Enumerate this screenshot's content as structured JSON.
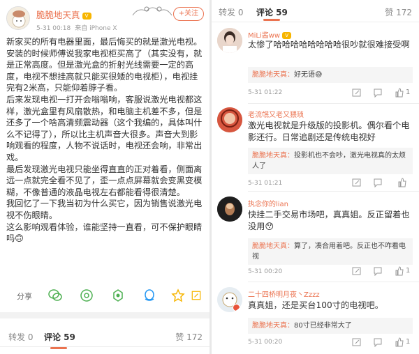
{
  "post": {
    "author": "脆脆地天真",
    "date": "5-31 00:18",
    "source": "来自 iPhone X",
    "follow_label": "+关注",
    "body": [
      "新家买的所有电器里面，最后悔买的就是激光电视。",
      "安装的时候师傅说我家电视柜买高了（其实没有，就是正常高度。但是激光盒的折射光线需要一定的高度，电视不想挂高就只能买很矮的电视柜），电视挂完有2米高，只能仰着脖子看。",
      "后来发现电视一打开会嗡嗡响，客服说激光电视都这样，激光盒里有风扇散热，和电脑主机差不多，但是还多了一个啥高清频震动器（这个我编的，具体叫什么不记得了），所以比主机声音大很多。声音大到影响观看的程度，人物不说话时，电视还会响，非常出戏。",
      "最后发现激光电视只能坐得直直的正对着看，侧面离远一点就完全看不见了，歪一点点屏幕就会变黑变模糊，不像普通的液晶电视左右都能看得很清楚。",
      "我回忆了一下我当初为什么买它，因为销售说激光电视不伤眼睛。",
      "这么影响观看体验，谁能坚持一直看，可不保护眼睛吗🙃"
    ],
    "share_label": "分享",
    "share_icons": [
      "wechat-icon",
      "moments-icon",
      "weibo-friends-icon",
      "qq-icon",
      "favorite-star-icon",
      "edit-icon"
    ]
  },
  "tabs": {
    "repost": "转发 0",
    "comments": "评论 59",
    "likes": "赞 172"
  },
  "colors": {
    "accent": "#eb7350",
    "link": "#eb7350"
  },
  "comments": [
    {
      "name": "MiLi酱ww",
      "text": "太惨了哈哈哈哈哈哈哈哈很吵就很难接受啊",
      "reply_name": "脆脆地天真：",
      "reply_text": "好无语😅",
      "time": "5-31 01:22",
      "likes": "1"
    },
    {
      "name": "老流氓又老又猥琐",
      "text": "激光电视就是升级版的投影机。偶尔看个电影还行。日常追剧还是传统电视好",
      "reply_name": "脆脆地天真：",
      "reply_text": "投影机也不会吵，激光电视真的太烦人了",
      "time": "5-31 01:21",
      "likes": ""
    },
    {
      "name": "执念你的lian",
      "text": "快挂二手交易市场吧，真真姐。反正留着也没用😯",
      "reply_name": "脆脆地天真：",
      "reply_text": "算了，凑合用着吧。反正也不咋看电视",
      "time": "5-31 00:20",
      "likes": "1"
    },
    {
      "name": "二十四桥明月夜丶Zzzz",
      "text": "真真姐，还是买台100寸的电视吧。",
      "reply_name": "脆脆地天真：",
      "reply_text": "80寸已经非常大了",
      "time": "5-31 00:20",
      "likes": "1"
    }
  ]
}
